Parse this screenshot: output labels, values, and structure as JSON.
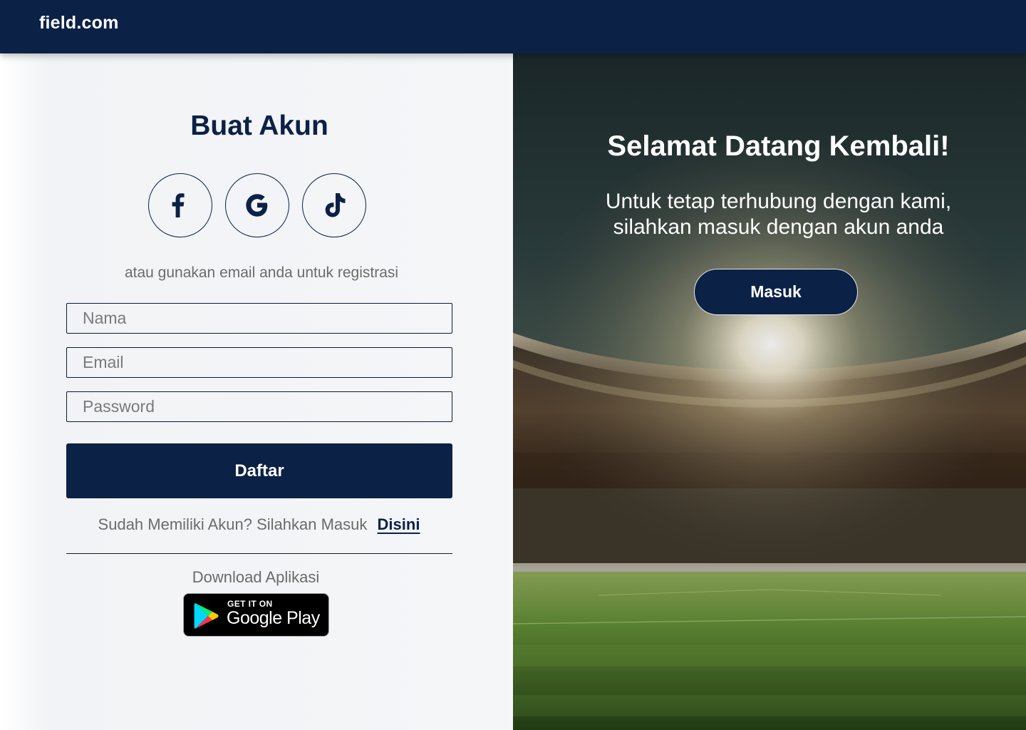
{
  "header": {
    "brand": "field.com"
  },
  "register": {
    "title": "Buat Akun",
    "social": [
      {
        "name": "facebook",
        "icon": "facebook-icon"
      },
      {
        "name": "google",
        "icon": "google-icon"
      },
      {
        "name": "tiktok",
        "icon": "tiktok-icon"
      }
    ],
    "alt_text": "atau gunakan email anda untuk registrasi",
    "fields": {
      "name_placeholder": "Nama",
      "email_placeholder": "Email",
      "password_placeholder": "Password"
    },
    "submit_label": "Daftar",
    "login_prompt": "Sudah Memiliki Akun? Silahkan Masuk",
    "login_link": "Disini",
    "download_label": "Download Aplikasi",
    "store_badge": {
      "small": "GET IT ON",
      "big": "Google Play"
    }
  },
  "welcome": {
    "title": "Selamat Datang Kembali!",
    "subtitle_line1": "Untuk tetap terhubung dengan kami,",
    "subtitle_line2": "silahkan masuk dengan akun anda",
    "button_label": "Masuk",
    "background": "stadium-image"
  },
  "colors": {
    "primary": "#0b2146",
    "panel_bg": "#f5f6f8",
    "muted_text": "#6b6b6b"
  }
}
